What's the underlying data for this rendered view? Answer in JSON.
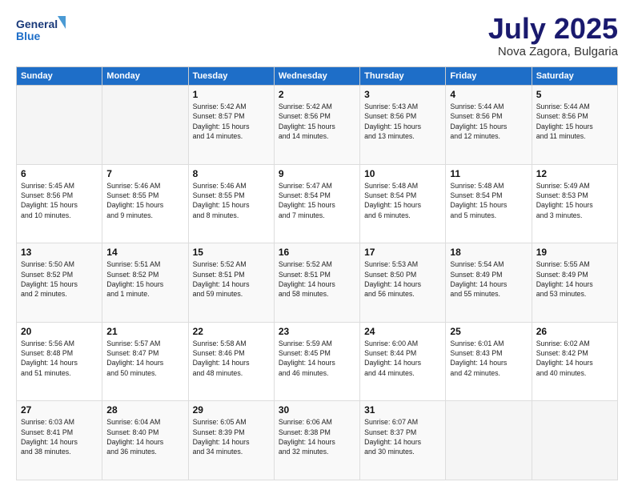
{
  "header": {
    "logo_line1": "General",
    "logo_line2": "Blue",
    "month": "July 2025",
    "location": "Nova Zagora, Bulgaria"
  },
  "weekdays": [
    "Sunday",
    "Monday",
    "Tuesday",
    "Wednesday",
    "Thursday",
    "Friday",
    "Saturday"
  ],
  "weeks": [
    [
      {
        "day": "",
        "info": ""
      },
      {
        "day": "",
        "info": ""
      },
      {
        "day": "1",
        "info": "Sunrise: 5:42 AM\nSunset: 8:57 PM\nDaylight: 15 hours\nand 14 minutes."
      },
      {
        "day": "2",
        "info": "Sunrise: 5:42 AM\nSunset: 8:56 PM\nDaylight: 15 hours\nand 14 minutes."
      },
      {
        "day": "3",
        "info": "Sunrise: 5:43 AM\nSunset: 8:56 PM\nDaylight: 15 hours\nand 13 minutes."
      },
      {
        "day": "4",
        "info": "Sunrise: 5:44 AM\nSunset: 8:56 PM\nDaylight: 15 hours\nand 12 minutes."
      },
      {
        "day": "5",
        "info": "Sunrise: 5:44 AM\nSunset: 8:56 PM\nDaylight: 15 hours\nand 11 minutes."
      }
    ],
    [
      {
        "day": "6",
        "info": "Sunrise: 5:45 AM\nSunset: 8:56 PM\nDaylight: 15 hours\nand 10 minutes."
      },
      {
        "day": "7",
        "info": "Sunrise: 5:46 AM\nSunset: 8:55 PM\nDaylight: 15 hours\nand 9 minutes."
      },
      {
        "day": "8",
        "info": "Sunrise: 5:46 AM\nSunset: 8:55 PM\nDaylight: 15 hours\nand 8 minutes."
      },
      {
        "day": "9",
        "info": "Sunrise: 5:47 AM\nSunset: 8:54 PM\nDaylight: 15 hours\nand 7 minutes."
      },
      {
        "day": "10",
        "info": "Sunrise: 5:48 AM\nSunset: 8:54 PM\nDaylight: 15 hours\nand 6 minutes."
      },
      {
        "day": "11",
        "info": "Sunrise: 5:48 AM\nSunset: 8:54 PM\nDaylight: 15 hours\nand 5 minutes."
      },
      {
        "day": "12",
        "info": "Sunrise: 5:49 AM\nSunset: 8:53 PM\nDaylight: 15 hours\nand 3 minutes."
      }
    ],
    [
      {
        "day": "13",
        "info": "Sunrise: 5:50 AM\nSunset: 8:52 PM\nDaylight: 15 hours\nand 2 minutes."
      },
      {
        "day": "14",
        "info": "Sunrise: 5:51 AM\nSunset: 8:52 PM\nDaylight: 15 hours\nand 1 minute."
      },
      {
        "day": "15",
        "info": "Sunrise: 5:52 AM\nSunset: 8:51 PM\nDaylight: 14 hours\nand 59 minutes."
      },
      {
        "day": "16",
        "info": "Sunrise: 5:52 AM\nSunset: 8:51 PM\nDaylight: 14 hours\nand 58 minutes."
      },
      {
        "day": "17",
        "info": "Sunrise: 5:53 AM\nSunset: 8:50 PM\nDaylight: 14 hours\nand 56 minutes."
      },
      {
        "day": "18",
        "info": "Sunrise: 5:54 AM\nSunset: 8:49 PM\nDaylight: 14 hours\nand 55 minutes."
      },
      {
        "day": "19",
        "info": "Sunrise: 5:55 AM\nSunset: 8:49 PM\nDaylight: 14 hours\nand 53 minutes."
      }
    ],
    [
      {
        "day": "20",
        "info": "Sunrise: 5:56 AM\nSunset: 8:48 PM\nDaylight: 14 hours\nand 51 minutes."
      },
      {
        "day": "21",
        "info": "Sunrise: 5:57 AM\nSunset: 8:47 PM\nDaylight: 14 hours\nand 50 minutes."
      },
      {
        "day": "22",
        "info": "Sunrise: 5:58 AM\nSunset: 8:46 PM\nDaylight: 14 hours\nand 48 minutes."
      },
      {
        "day": "23",
        "info": "Sunrise: 5:59 AM\nSunset: 8:45 PM\nDaylight: 14 hours\nand 46 minutes."
      },
      {
        "day": "24",
        "info": "Sunrise: 6:00 AM\nSunset: 8:44 PM\nDaylight: 14 hours\nand 44 minutes."
      },
      {
        "day": "25",
        "info": "Sunrise: 6:01 AM\nSunset: 8:43 PM\nDaylight: 14 hours\nand 42 minutes."
      },
      {
        "day": "26",
        "info": "Sunrise: 6:02 AM\nSunset: 8:42 PM\nDaylight: 14 hours\nand 40 minutes."
      }
    ],
    [
      {
        "day": "27",
        "info": "Sunrise: 6:03 AM\nSunset: 8:41 PM\nDaylight: 14 hours\nand 38 minutes."
      },
      {
        "day": "28",
        "info": "Sunrise: 6:04 AM\nSunset: 8:40 PM\nDaylight: 14 hours\nand 36 minutes."
      },
      {
        "day": "29",
        "info": "Sunrise: 6:05 AM\nSunset: 8:39 PM\nDaylight: 14 hours\nand 34 minutes."
      },
      {
        "day": "30",
        "info": "Sunrise: 6:06 AM\nSunset: 8:38 PM\nDaylight: 14 hours\nand 32 minutes."
      },
      {
        "day": "31",
        "info": "Sunrise: 6:07 AM\nSunset: 8:37 PM\nDaylight: 14 hours\nand 30 minutes."
      },
      {
        "day": "",
        "info": ""
      },
      {
        "day": "",
        "info": ""
      }
    ]
  ]
}
